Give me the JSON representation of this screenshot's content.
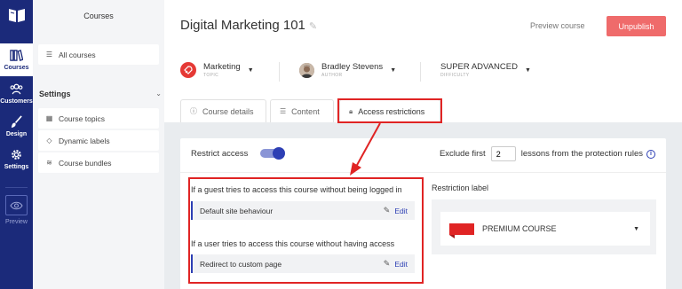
{
  "rail": {
    "items": [
      {
        "label": "Courses",
        "icon": "books-icon"
      },
      {
        "label": "Customers",
        "icon": "users-icon"
      },
      {
        "label": "Design",
        "icon": "brush-icon"
      },
      {
        "label": "Settings",
        "icon": "gear-icon"
      }
    ],
    "preview_label": "Preview"
  },
  "sidebar": {
    "title": "Courses",
    "all_courses": "All courses",
    "settings_heading": "Settings",
    "items": [
      {
        "label": "Course topics"
      },
      {
        "label": "Dynamic labels"
      },
      {
        "label": "Course bundles"
      }
    ]
  },
  "header": {
    "course_title": "Digital Marketing 101",
    "preview_course": "Preview course",
    "unpublish": "Unpublish"
  },
  "meta": {
    "topic": {
      "value": "Marketing",
      "sub": "TOPIC"
    },
    "author": {
      "value": "Bradley Stevens",
      "sub": "AUTHOR"
    },
    "difficulty": {
      "value": "SUPER ADVANCED",
      "sub": "DIFFICULTY"
    }
  },
  "tabs": [
    {
      "label": "Course details"
    },
    {
      "label": "Content"
    },
    {
      "label": "Access restrictions"
    }
  ],
  "restrictions": {
    "restrict_access_label": "Restrict access",
    "restrict_access_on": true,
    "exclude_prefix": "Exclude first",
    "exclude_value": "2",
    "exclude_suffix": "lessons from the protection rules",
    "guest_question": "If a guest tries to access this course without being logged in",
    "guest_option": "Default site behaviour",
    "user_question": "If a user tries to access this course without having access",
    "user_option": "Redirect to custom page",
    "edit_label": "Edit",
    "restriction_label_title": "Restriction label",
    "restriction_label_value": "PREMIUM COURSE"
  },
  "colors": {
    "rail_bg": "#1b2a7a",
    "accent_blue": "#2d3fb4",
    "unpublish_red": "#ef6b6b",
    "highlight_red": "#e02424"
  }
}
